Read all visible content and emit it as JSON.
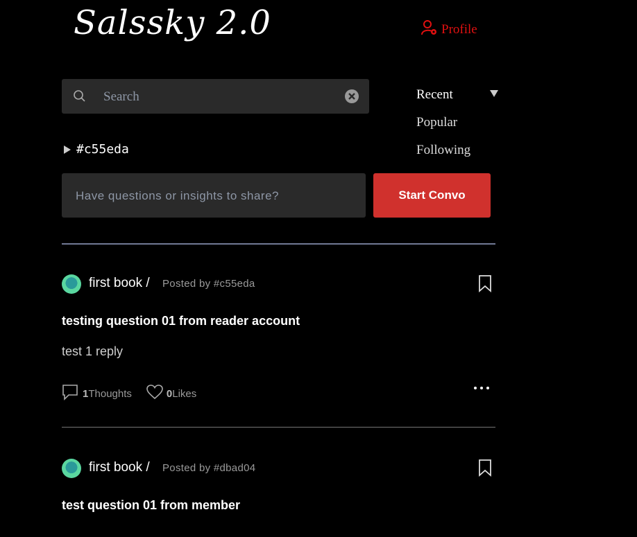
{
  "header": {
    "logo_text": "Salssky 2.0",
    "profile_label": "Profile"
  },
  "search": {
    "placeholder": "Search",
    "value": ""
  },
  "sort": {
    "options": [
      "Recent",
      "Popular",
      "Following"
    ],
    "selected": "Recent"
  },
  "tag_filter": "#c55eda",
  "composer": {
    "placeholder": "Have questions or insights to share?",
    "button_label": "Start Convo"
  },
  "posts": [
    {
      "category": "first book /",
      "posted_by": "Posted by #c55eda",
      "question": "testing question 01 from reader account",
      "body": "test 1 reply",
      "thoughts_count": "1",
      "thoughts_label": "Thoughts",
      "likes_count": "0",
      "likes_label": "Likes"
    },
    {
      "category": "first book /",
      "posted_by": "Posted by #dbad04",
      "question": "test question 01 from member",
      "body": "",
      "thoughts_count": "",
      "thoughts_label": "",
      "likes_count": "",
      "likes_label": ""
    }
  ],
  "colors": {
    "accent_red": "#d0312d",
    "profile_red": "#e01010",
    "divider": "#727a96"
  }
}
